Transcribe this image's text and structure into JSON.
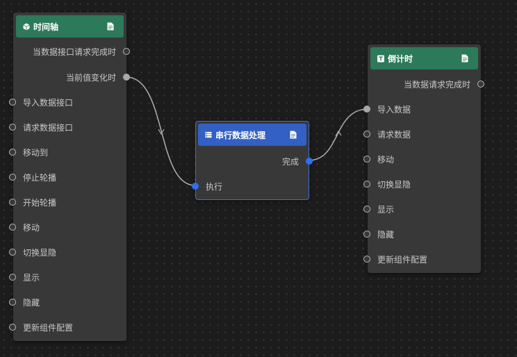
{
  "nodes": {
    "timeline": {
      "title": "时间轴",
      "icon": "cube-icon",
      "header_color": "#2c7a5a",
      "outputs": [
        "当数据接口请求完成时",
        "当前值变化时"
      ],
      "inputs": [
        "导入数据接口",
        "请求数据接口",
        "移动到",
        "停止轮播",
        "开始轮播",
        "移动",
        "切换显隐",
        "显示",
        "隐藏",
        "更新组件配置"
      ]
    },
    "serial": {
      "title": "串行数据处理",
      "icon": "serial-process-icon",
      "header_color": "#3360c4",
      "outputs": [
        "完成"
      ],
      "inputs": [
        "执行"
      ]
    },
    "countdown": {
      "title": "倒计时",
      "icon": "text-t-icon",
      "header_color": "#2c7a5a",
      "outputs": [
        "当数据请求完成时"
      ],
      "inputs": [
        "导入数据",
        "请求数据",
        "移动",
        "切换显隐",
        "显示",
        "隐藏",
        "更新组件配置"
      ]
    }
  },
  "colors": {
    "canvas": "#1c1c1c",
    "node_body": "#383838",
    "link": "#b0b0b0",
    "selection": "#3b6fd6",
    "active_port": "#2f6ff0"
  }
}
